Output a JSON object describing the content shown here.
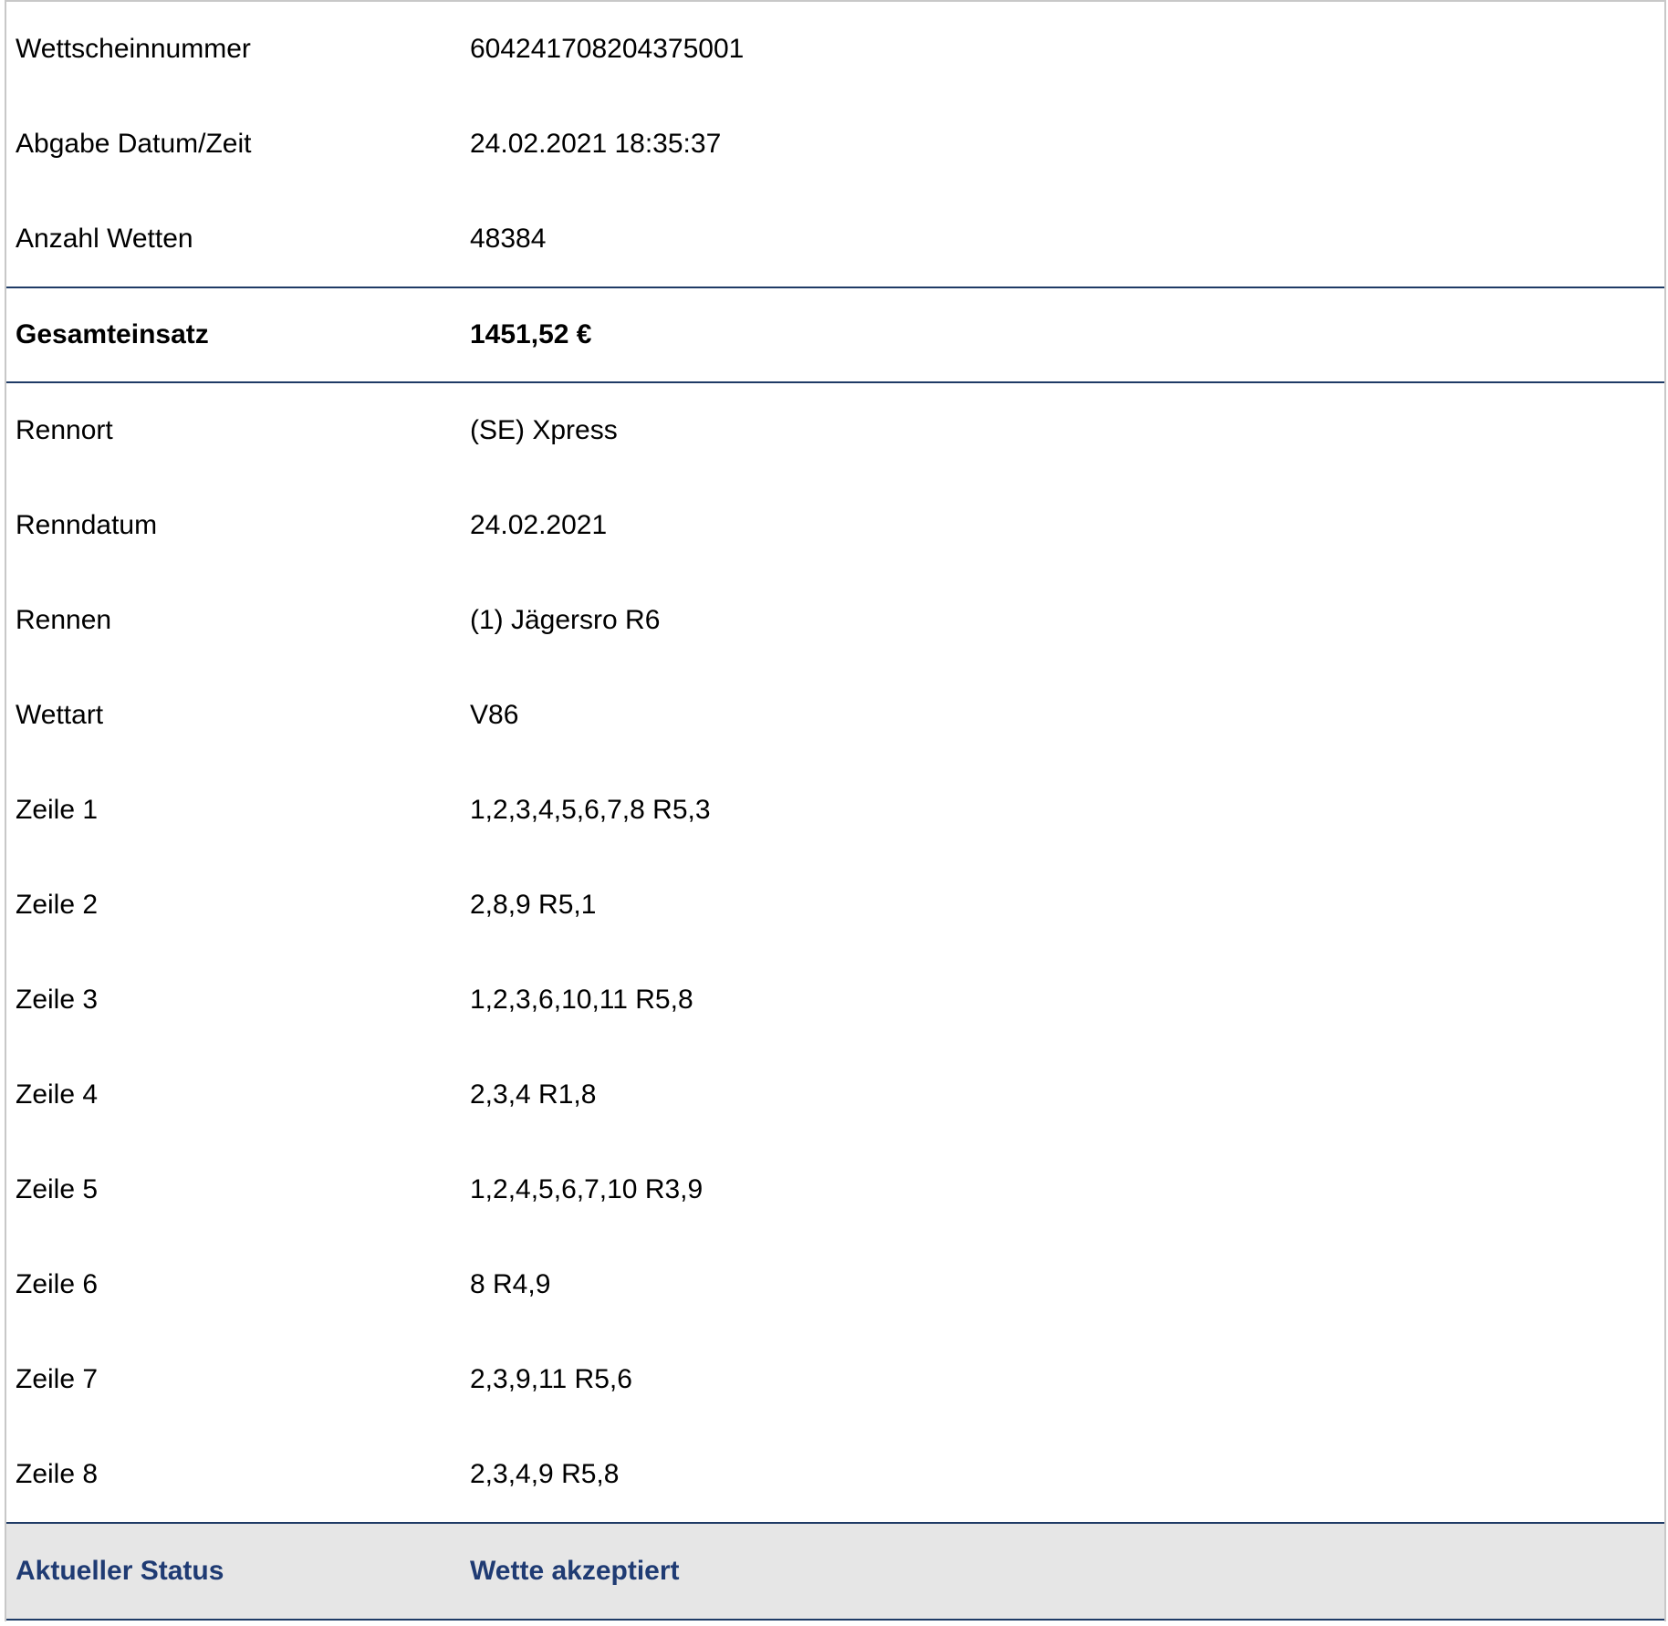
{
  "ticket": {
    "header_rows": [
      {
        "label": "Wettscheinnummer",
        "value": "604241708204375001"
      },
      {
        "label": "Abgabe Datum/Zeit",
        "value": "24.02.2021 18:35:37"
      },
      {
        "label": "Anzahl Wetten",
        "value": "48384"
      }
    ],
    "total": {
      "label": "Gesamteinsatz",
      "value": "1451,52 €"
    },
    "detail_rows": [
      {
        "label": "Rennort",
        "value": "(SE) Xpress"
      },
      {
        "label": "Renndatum",
        "value": "24.02.2021"
      },
      {
        "label": "Rennen",
        "value": "(1) Jägersro R6"
      },
      {
        "label": "Wettart",
        "value": "V86"
      },
      {
        "label": "Zeile 1",
        "value": "1,2,3,4,5,6,7,8 R5,3"
      },
      {
        "label": "Zeile 2",
        "value": "2,8,9 R5,1"
      },
      {
        "label": "Zeile 3",
        "value": "1,2,3,6,10,11 R5,8"
      },
      {
        "label": "Zeile 4",
        "value": "2,3,4 R1,8"
      },
      {
        "label": "Zeile 5",
        "value": "1,2,4,5,6,7,10 R3,9"
      },
      {
        "label": "Zeile 6",
        "value": "8 R4,9"
      },
      {
        "label": "Zeile 7",
        "value": "2,3,9,11 R5,6"
      },
      {
        "label": "Zeile 8",
        "value": "2,3,4,9 R5,8"
      }
    ],
    "status": {
      "label": "Aktueller Status",
      "value": "Wette akzeptiert"
    }
  },
  "colors": {
    "divider": "#1f3b66",
    "status_text": "#1f3b73",
    "status_background": "#e6e6e6",
    "outer_border": "#c8c8c8"
  }
}
